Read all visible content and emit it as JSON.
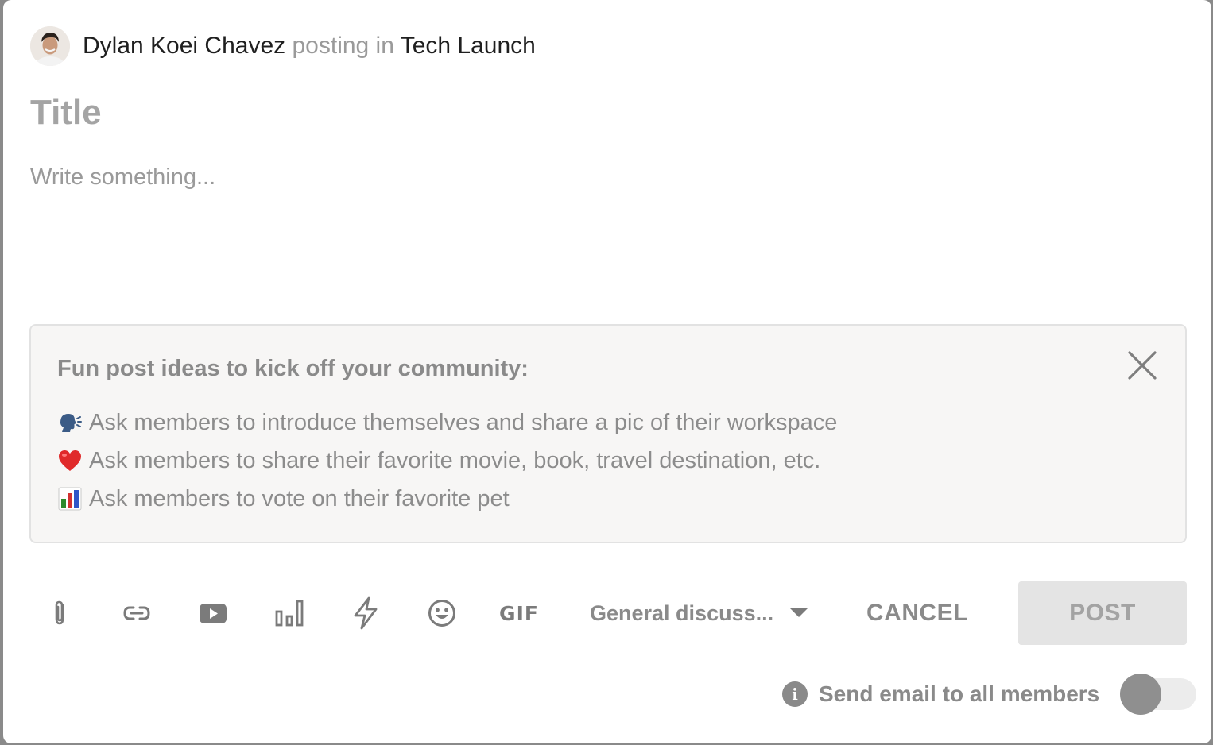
{
  "header": {
    "author_name": "Dylan Koei Chavez",
    "connector": "posting in",
    "community_name": "Tech Launch"
  },
  "composer": {
    "title_placeholder": "Title",
    "body_placeholder": "Write something..."
  },
  "ideas": {
    "heading": "Fun post ideas to kick off your community:",
    "items": [
      {
        "icon": "speaking-head-icon",
        "text": "Ask members to introduce themselves and share a pic of their workspace"
      },
      {
        "icon": "red-heart-icon",
        "text": "Ask members to share their favorite movie, book, travel destination, etc."
      },
      {
        "icon": "bar-chart-icon",
        "text": "Ask members to vote on their favorite pet"
      }
    ]
  },
  "toolbar": {
    "tools": [
      "paperclip-icon",
      "link-icon",
      "youtube-icon",
      "poll-icon",
      "lightning-icon",
      "emoji-icon",
      "gif-icon"
    ],
    "gif_label": "GIF",
    "category_label": "General discuss...",
    "cancel_label": "CANCEL",
    "post_label": "POST"
  },
  "email": {
    "label": "Send email to all members",
    "enabled": false
  },
  "colors": {
    "icon_gray": "#7b7b7b",
    "muted_text": "#8a8a8a",
    "ideas_background": "#f7f6f5",
    "post_button_bg": "#e4e4e4"
  }
}
